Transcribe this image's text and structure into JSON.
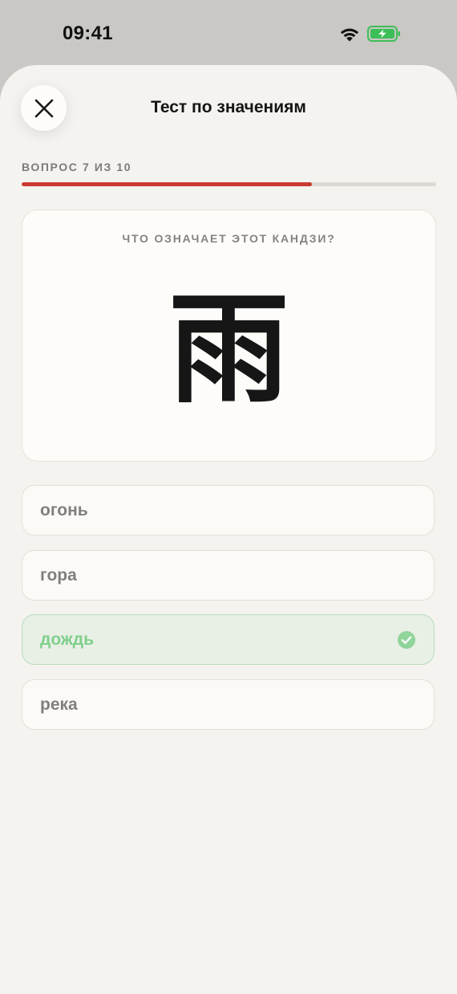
{
  "status_bar": {
    "time": "09:41",
    "wifi_icon": "wifi-icon",
    "battery_icon": "battery-charging-icon",
    "battery_color": "#3dbf58"
  },
  "header": {
    "title": "Тест по значениям",
    "close_icon": "close-icon"
  },
  "progress": {
    "label": "ВОПРОС 7 ИЗ 10",
    "current": 7,
    "total": 10,
    "fill_fraction": 0.7,
    "fill_color": "#c93a30"
  },
  "question": {
    "prompt": "ЧТО ОЗНАЧАЕТ ЭТОТ КАНДЗИ?",
    "kanji": "雨"
  },
  "answers": [
    {
      "label": "огонь",
      "state": "neutral"
    },
    {
      "label": "гора",
      "state": "neutral"
    },
    {
      "label": "дождь",
      "state": "correct"
    },
    {
      "label": "река",
      "state": "neutral"
    }
  ],
  "colors": {
    "correct": "#7fcf8c",
    "background": "#f5f3ef"
  }
}
